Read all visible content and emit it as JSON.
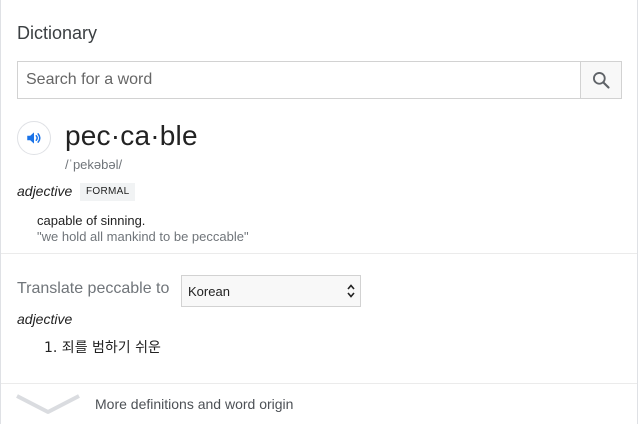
{
  "title": "Dictionary",
  "search": {
    "placeholder": "Search for a word",
    "value": ""
  },
  "entry": {
    "word": "pec·ca·ble",
    "phonetic": "/ˈpekəbəl/",
    "part_of_speech": "adjective",
    "register_label": "FORMAL",
    "definition": "capable of sinning.",
    "example": "\"we hold all mankind to be peccable\""
  },
  "translate": {
    "label": "Translate peccable to",
    "language": "Korean",
    "part_of_speech": "adjective",
    "items": [
      "1. 죄를 범하기 쉬운"
    ]
  },
  "more": {
    "label": "More definitions and word origin"
  },
  "colors": {
    "accent_blue": "#1a73e8",
    "muted_text": "#70757a",
    "chip_bg": "#f1f3f4"
  },
  "icons": {
    "search": "search-icon",
    "audio": "speaker-icon",
    "expand": "chevron-down-icon",
    "select": "up-down-arrows-icon"
  }
}
